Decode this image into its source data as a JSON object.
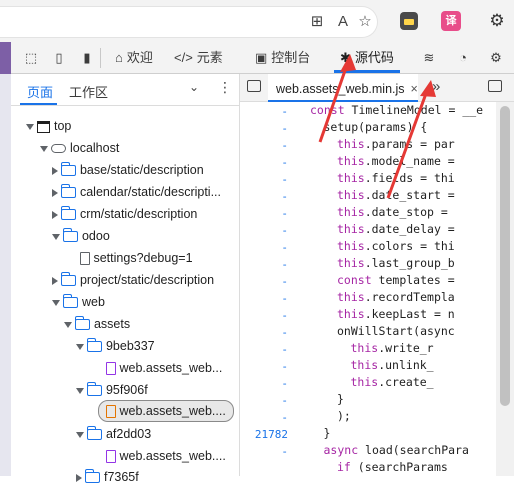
{
  "browser": {
    "address_icons": [
      "split-screen-icon",
      "read-aloud-icon",
      "favorite-icon"
    ],
    "extensions": [
      "wallet-extension-icon",
      "translate-extension-icon",
      "settings-extension-icon"
    ],
    "translate_glyph": "译"
  },
  "devtools": {
    "toolbar_icons": [
      "inspect-element-icon",
      "device-toolbar-icon",
      "sidebar-toggle-icon"
    ],
    "tabs": [
      {
        "label": "欢迎",
        "icon": "home-icon"
      },
      {
        "label": "元素",
        "icon": "code-tag-icon"
      },
      {
        "label": "控制台",
        "icon": "console-icon"
      },
      {
        "label": "源代码",
        "icon": "bug-icon",
        "active": true
      }
    ],
    "more_icons": [
      "network-icon",
      "performance-icon",
      "settings-gear-icon"
    ]
  },
  "navigator": {
    "tabs": [
      "页面",
      "工作区"
    ],
    "tree": [
      {
        "label": "top"
      },
      {
        "label": "localhost"
      },
      {
        "label": "base/static/description"
      },
      {
        "label": "calendar/static/descripti..."
      },
      {
        "label": "crm/static/description"
      },
      {
        "label": "odoo"
      },
      {
        "label": "settings?debug=1"
      },
      {
        "label": "project/static/description"
      },
      {
        "label": "web"
      },
      {
        "label": "assets"
      },
      {
        "label": "9beb337"
      },
      {
        "label": "web.assets_web..."
      },
      {
        "label": "95f906f"
      },
      {
        "label": "web.assets_web...."
      },
      {
        "label": "af2dd03"
      },
      {
        "label": "web.assets_web...."
      },
      {
        "label": "f7365f"
      }
    ]
  },
  "editor": {
    "file_tab": "web.assets_web.min.js",
    "close_glyph": "×",
    "gutter": [
      "-",
      "-",
      "-",
      "-",
      "-",
      "-",
      "-",
      "-",
      "-",
      "-",
      "-",
      "-",
      "-",
      "-",
      "-",
      "-",
      "-",
      "-",
      "-",
      "21782",
      "-"
    ],
    "code_lines": [
      {
        "indent": 2,
        "text": "const TimelineModel = __e"
      },
      {
        "indent": 3,
        "text": "setup(params) {"
      },
      {
        "indent": 4,
        "text": "this.params = par"
      },
      {
        "indent": 4,
        "text": "this.model_name ="
      },
      {
        "indent": 4,
        "text": "this.fields = thi"
      },
      {
        "indent": 4,
        "text": "this.date_start ="
      },
      {
        "indent": 4,
        "text": "this.date_stop = "
      },
      {
        "indent": 4,
        "text": "this.date_delay ="
      },
      {
        "indent": 4,
        "text": "this.colors = thi"
      },
      {
        "indent": 4,
        "text": "this.last_group_b"
      },
      {
        "indent": 4,
        "text": "const templates ="
      },
      {
        "indent": 4,
        "text": "this.recordTempla"
      },
      {
        "indent": 4,
        "text": "this.keepLast = n"
      },
      {
        "indent": 4,
        "text": "onWillStart(async"
      },
      {
        "indent": 5,
        "text": "this.write_r"
      },
      {
        "indent": 5,
        "text": "this.unlink_"
      },
      {
        "indent": 5,
        "text": "this.create_"
      },
      {
        "indent": 4,
        "text": "}"
      },
      {
        "indent": 4,
        "text": ");"
      },
      {
        "indent": 3,
        "text": "}"
      },
      {
        "indent": 3,
        "text": "async load(searchPara"
      },
      {
        "indent": 4,
        "text": "if (searchParams"
      }
    ]
  },
  "colors": {
    "accent": "#1a73e8",
    "annotation": "#e53935"
  }
}
